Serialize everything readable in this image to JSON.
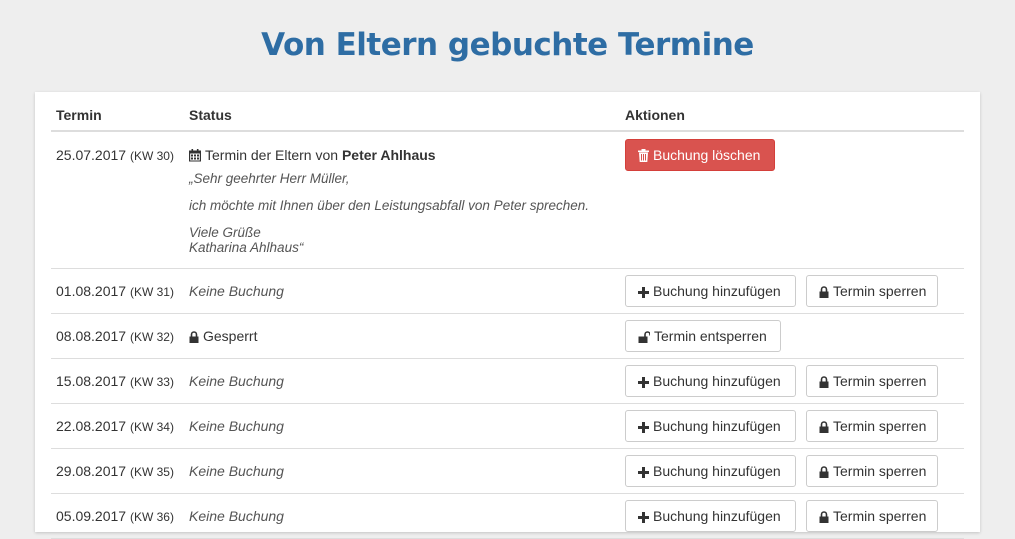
{
  "page": {
    "title": "Von Eltern gebuchte Termine"
  },
  "table": {
    "headers": {
      "termin": "Termin",
      "status": "Status",
      "aktionen": "Aktionen"
    }
  },
  "booked": {
    "date": "25.07.2017",
    "kw": "(KW 30)",
    "status_prefix": "Termin der Eltern von",
    "parent_name": "Peter Ahlhaus",
    "message_line1": "„Sehr geehrter Herr Müller,",
    "message_line2": "ich möchte mit Ihnen über den Leistungsabfall von Peter sprechen.",
    "message_line3": "Viele Grüße",
    "message_line4": "Katharina Ahlhaus“",
    "delete_label": "Buchung löschen"
  },
  "rows": [
    {
      "date": "01.08.2017",
      "kw": "(KW 31)",
      "status": "Keine Buchung",
      "add_label": "Buchung hinzufügen",
      "lock_label": "Termin sperren"
    },
    {
      "date": "08.08.2017",
      "kw": "(KW 32)",
      "status": "Gesperrt",
      "unlock_label": "Termin entsperren"
    },
    {
      "date": "15.08.2017",
      "kw": "(KW 33)",
      "status": "Keine Buchung",
      "add_label": "Buchung hinzufügen",
      "lock_label": "Termin sperren"
    },
    {
      "date": "22.08.2017",
      "kw": "(KW 34)",
      "status": "Keine Buchung",
      "add_label": "Buchung hinzufügen",
      "lock_label": "Termin sperren"
    },
    {
      "date": "29.08.2017",
      "kw": "(KW 35)",
      "status": "Keine Buchung",
      "add_label": "Buchung hinzufügen",
      "lock_label": "Termin sperren"
    },
    {
      "date": "05.09.2017",
      "kw": "(KW 36)",
      "status": "Keine Buchung",
      "add_label": "Buchung hinzufügen",
      "lock_label": "Termin sperren"
    }
  ],
  "colors": {
    "title": "#2e6da4",
    "danger": "#d9534f",
    "background": "#eeeeee"
  },
  "icons": {
    "calendar": "calendar-icon",
    "trash": "trash-icon",
    "plus": "plus-icon",
    "lock": "lock-icon",
    "unlock": "unlock-icon"
  }
}
